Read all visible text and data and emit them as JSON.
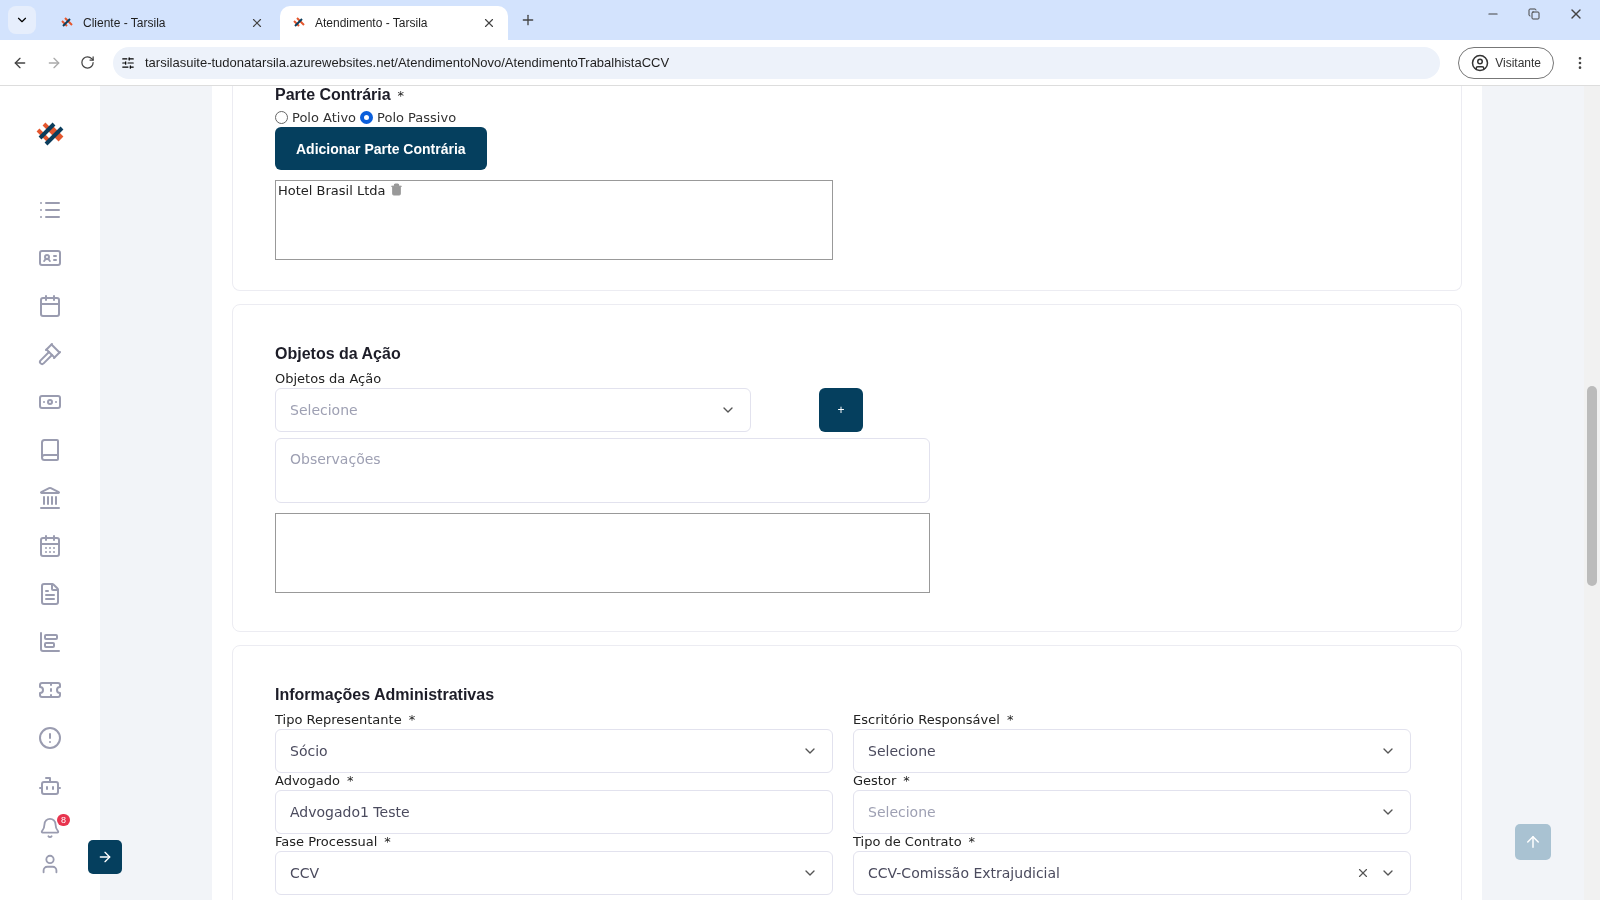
{
  "browser": {
    "tabs": [
      {
        "title": "Cliente - Tarsila",
        "selected": false
      },
      {
        "title": "Atendimento - Tarsila",
        "selected": true
      }
    ],
    "url": "tarsilasuite-tudonatarsila.azurewebsites.net/AtendimentoNovo/AtendimentoTrabalhistaCCV",
    "profile": "Visitante"
  },
  "sidebar": {
    "notification_count": "8"
  },
  "parte_contraria": {
    "title": "Parte Contrária",
    "required_mark": "*",
    "options": [
      {
        "label": "Polo Ativo",
        "selected": false
      },
      {
        "label": "Polo Passivo",
        "selected": true
      }
    ],
    "add_button": "Adicionar Parte Contrária",
    "parties": [
      "Hotel Brasil Ltda"
    ]
  },
  "objetos": {
    "title": "Objetos da Ação",
    "label": "Objetos da Ação",
    "select_placeholder": "Selecione",
    "add_button": "+",
    "notes_placeholder": "Observações"
  },
  "admin": {
    "title": "Informações Administrativas",
    "fields": [
      {
        "label": "Tipo Representante",
        "required_mark": "*",
        "kind": "select",
        "value": "Sócio"
      },
      {
        "label": "Escritório Responsável",
        "required_mark": "*",
        "kind": "select",
        "value": "Selecione"
      },
      {
        "label": "Advogado",
        "required_mark": "*",
        "kind": "input",
        "value": "Advogado1 Teste"
      },
      {
        "label": "Gestor",
        "required_mark": "*",
        "kind": "select",
        "placeholder": "Selecione"
      },
      {
        "label": "Fase Processual",
        "required_mark": "*",
        "kind": "select",
        "value": "CCV"
      },
      {
        "label": "Tipo de Contrato",
        "required_mark": "*",
        "kind": "select",
        "value": "CCV-Comissão Extrajudicial",
        "clearable": true
      }
    ]
  }
}
